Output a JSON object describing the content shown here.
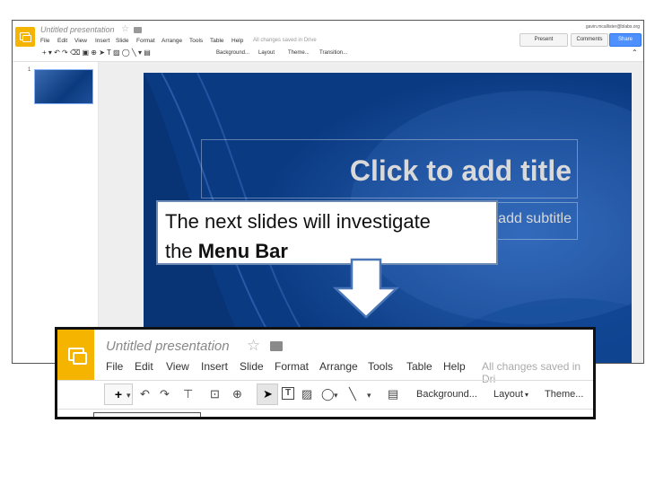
{
  "screenshot": {
    "doc_title": "Untitled presentation",
    "star_icon": "☆",
    "folder_icon": "folder-icon",
    "user": "gavin.mcallister@blabs.org",
    "menu": [
      "File",
      "Edit",
      "View",
      "Insert",
      "Slide",
      "Format",
      "Arrange",
      "Tools",
      "Table",
      "Help"
    ],
    "saved": "All changes saved in Drive",
    "present": "Present",
    "comments": "Comments",
    "share": "Share",
    "toolbar": {
      "background": "Background...",
      "layout": "Layout",
      "theme": "Theme...",
      "transition": "Transition..."
    },
    "slide_number": "1",
    "slide": {
      "title_placeholder": "Click to add title",
      "subtitle_placeholder": "Click to add subtitle"
    }
  },
  "callout": {
    "line1": "The next slides will investigate",
    "line2_prefix": "the ",
    "line2_bold": "Menu Bar"
  },
  "zoom": {
    "doc_title": "Untitled presentation",
    "star_icon": "☆",
    "menu": [
      "File",
      "Edit",
      "View",
      "Insert",
      "Slide",
      "Format",
      "Arrange",
      "Tools",
      "Table",
      "Help"
    ],
    "saved": "All changes saved in Dri",
    "toolbar": {
      "plus": "+",
      "background": "Background...",
      "layout": "Layout",
      "theme": "Theme..."
    }
  },
  "colors": {
    "brand": "#f4b400",
    "share": "#4d90fe",
    "slide": "#0a3a82",
    "callout_border": "#6b8ab3"
  }
}
